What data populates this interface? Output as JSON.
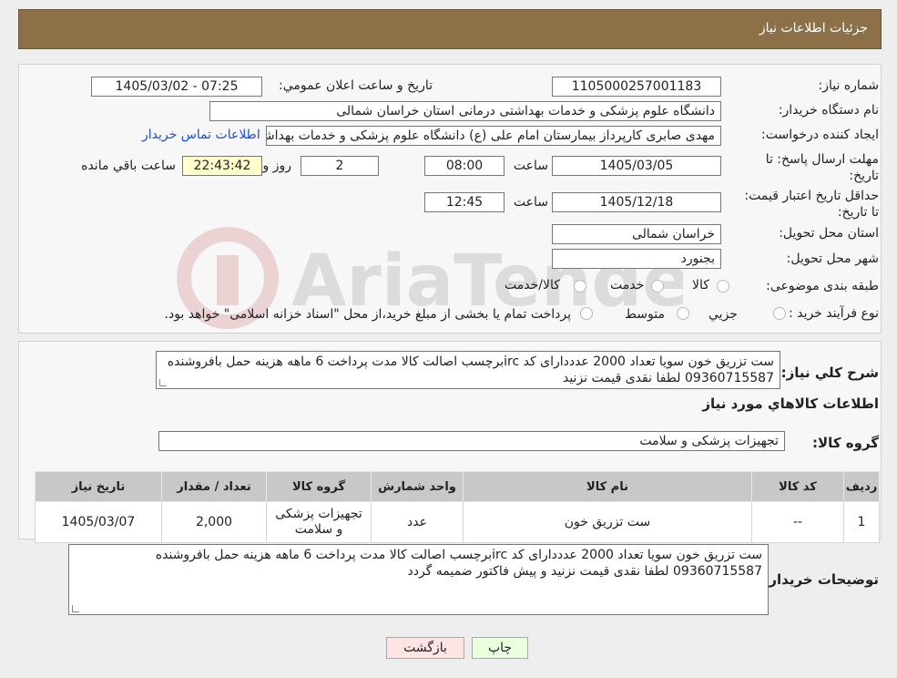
{
  "header": {
    "title": "جزئیات اطلاعات نیاز"
  },
  "form": {
    "need_number_label": "شماره نیاز:",
    "need_number": "1105000257001183",
    "announce_label": "تاریخ و ساعت اعلان عمومي:",
    "announce_value": "1405/03/02 - 07:25",
    "buyer_org_label": "نام دستگاه خريدار:",
    "buyer_org": "دانشگاه علوم پزشکی و خدمات بهداشتی درمانی استان خراسان شمالی",
    "requester_label": "ايجاد کننده درخواست:",
    "requester": "مهدی صابری کارپرداز بیمارستان امام علی (ع) دانشگاه علوم پزشکی و خدمات بهداشتی",
    "contact_link": "اطلاعات تماس خريدار",
    "deadline_label": "مهلت ارسال پاسخ: تا تاريخ:",
    "deadline_date": "1405/03/05",
    "time_label": "ساعت",
    "deadline_time": "08:00",
    "days_value": "2",
    "days_label": "روز و",
    "remaining_time": "22:43:42",
    "remaining_label": "ساعت باقي مانده",
    "validity_label": "حداقل تاريخ اعتبار قيمت: تا تاريخ:",
    "validity_date": "1405/12/18",
    "validity_time": "12:45",
    "province_label": "استان محل تحويل:",
    "province": "خراسان شمالی",
    "city_label": "شهر محل تحويل:",
    "city": "بجنورد",
    "category_label": "طبقه بندی موضوعی:",
    "category_options": [
      "كالا",
      "خدمت",
      "كالا/خدمت"
    ],
    "purchase_type_label": "نوع فرآيند خريد :",
    "purchase_options": [
      "جزيي",
      "متوسط"
    ],
    "purchase_note": "پرداخت تمام يا بخشی از مبلغ خريد،از محل \"اسناد خزانه اسلامی\" خواهد بود."
  },
  "description": {
    "label": "شرح کلي نياز:",
    "text": "ست تزریق خون سویا تعداد 2000 عدددارای کد ircبرچسب اصالت کالا مدت پرداخت 6 ماهه هزینه حمل بافروشنده 09360715587 لطفا نقدی قیمت نزنید"
  },
  "goods": {
    "section_title": "اطلاعات کالاهاي مورد نياز",
    "group_label": "گروه کالا:",
    "group_value": "تجهیزات پزشکی و سلامت",
    "columns": [
      "رديف",
      "کد کالا",
      "نام کالا",
      "واحد شمارش",
      "گروه کالا",
      "تعداد / مقدار",
      "تاريخ نياز"
    ],
    "rows": [
      [
        "1",
        "--",
        "ست تزریق خون",
        "عدد",
        "تجهیزات پزشکی و سلامت",
        "2,000",
        "1405/03/07"
      ]
    ]
  },
  "buyer_notes": {
    "label": "توضيحات خريدار:",
    "text": "ست تزریق خون سویا تعداد 2000 عدددارای کد ircبرچسب اصالت کالا مدت پرداخت 6 ماهه هزینه حمل بافروشنده 09360715587 لطفا نقدی قیمت نزنید و پیش فاکتور ضمیمه گردد"
  },
  "buttons": {
    "print": "چاپ",
    "back": "بازگشت"
  },
  "colors": {
    "header": "#8c7048",
    "remaining_bg": "#ffffcc",
    "print_bg": "#eaffe0",
    "back_bg": "#ffe4e4"
  }
}
